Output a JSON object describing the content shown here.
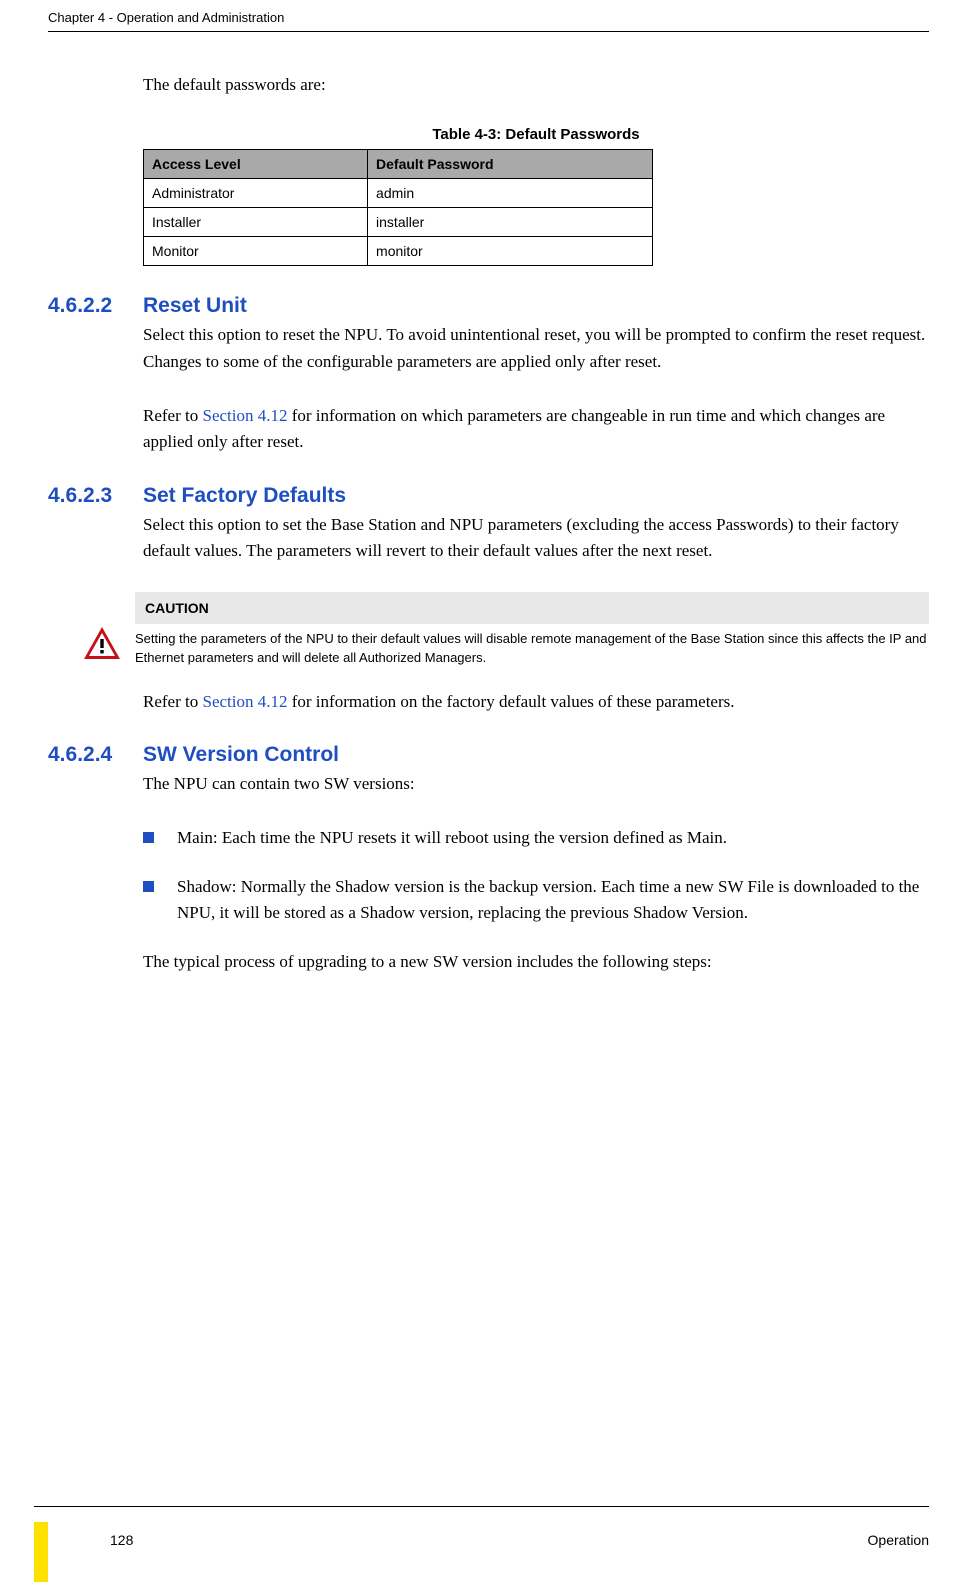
{
  "header": {
    "chapter_line": "Chapter 4 - Operation and Administration"
  },
  "intro": {
    "default_pw_sentence": "The default passwords are:"
  },
  "table": {
    "caption": "Table 4-3: Default Passwords",
    "headers": {
      "col1": "Access Level",
      "col2": "Default Password"
    },
    "rows": [
      {
        "level": "Administrator",
        "pw": "admin"
      },
      {
        "level": "Installer",
        "pw": "installer"
      },
      {
        "level": "Monitor",
        "pw": "monitor"
      }
    ]
  },
  "sections": {
    "reset": {
      "num": "4.6.2.2",
      "title": "Reset Unit",
      "p1": "Select this option to reset the NPU. To avoid unintentional reset, you will be prompted to confirm the reset request. Changes to some of the configurable parameters are applied only after reset.",
      "p2_pre": "Refer to ",
      "p2_link": "Section 4.12",
      "p2_post": " for information on which parameters are changeable in run time and which changes are applied only after reset."
    },
    "factory": {
      "num": "4.6.2.3",
      "title": "Set Factory Defaults",
      "p1": "Select this option to set the Base Station and NPU parameters (excluding the access Passwords) to their factory default values. The parameters will revert to their default values after the next reset.",
      "caution_label": "CAUTION",
      "caution_text": "Setting the parameters of the NPU to their default values will disable remote management of the Base Station since this affects the IP and Ethernet parameters and will delete all Authorized Managers.",
      "p2_pre": "Refer to ",
      "p2_link": "Section 4.12",
      "p2_post": " for information on the factory default values of these parameters."
    },
    "swver": {
      "num": "4.6.2.4",
      "title": "SW Version Control",
      "p1": "The NPU can contain two SW versions:",
      "bullets": [
        "Main: Each time the NPU resets it will reboot using the version defined as Main.",
        "Shadow: Normally the Shadow version is the backup version. Each time a new SW File is downloaded to the NPU, it will be stored as a Shadow version, replacing the previous Shadow Version."
      ],
      "p2": "The typical process of upgrading to a new SW version includes the following steps:"
    }
  },
  "footer": {
    "page": "128",
    "label": "Operation"
  }
}
